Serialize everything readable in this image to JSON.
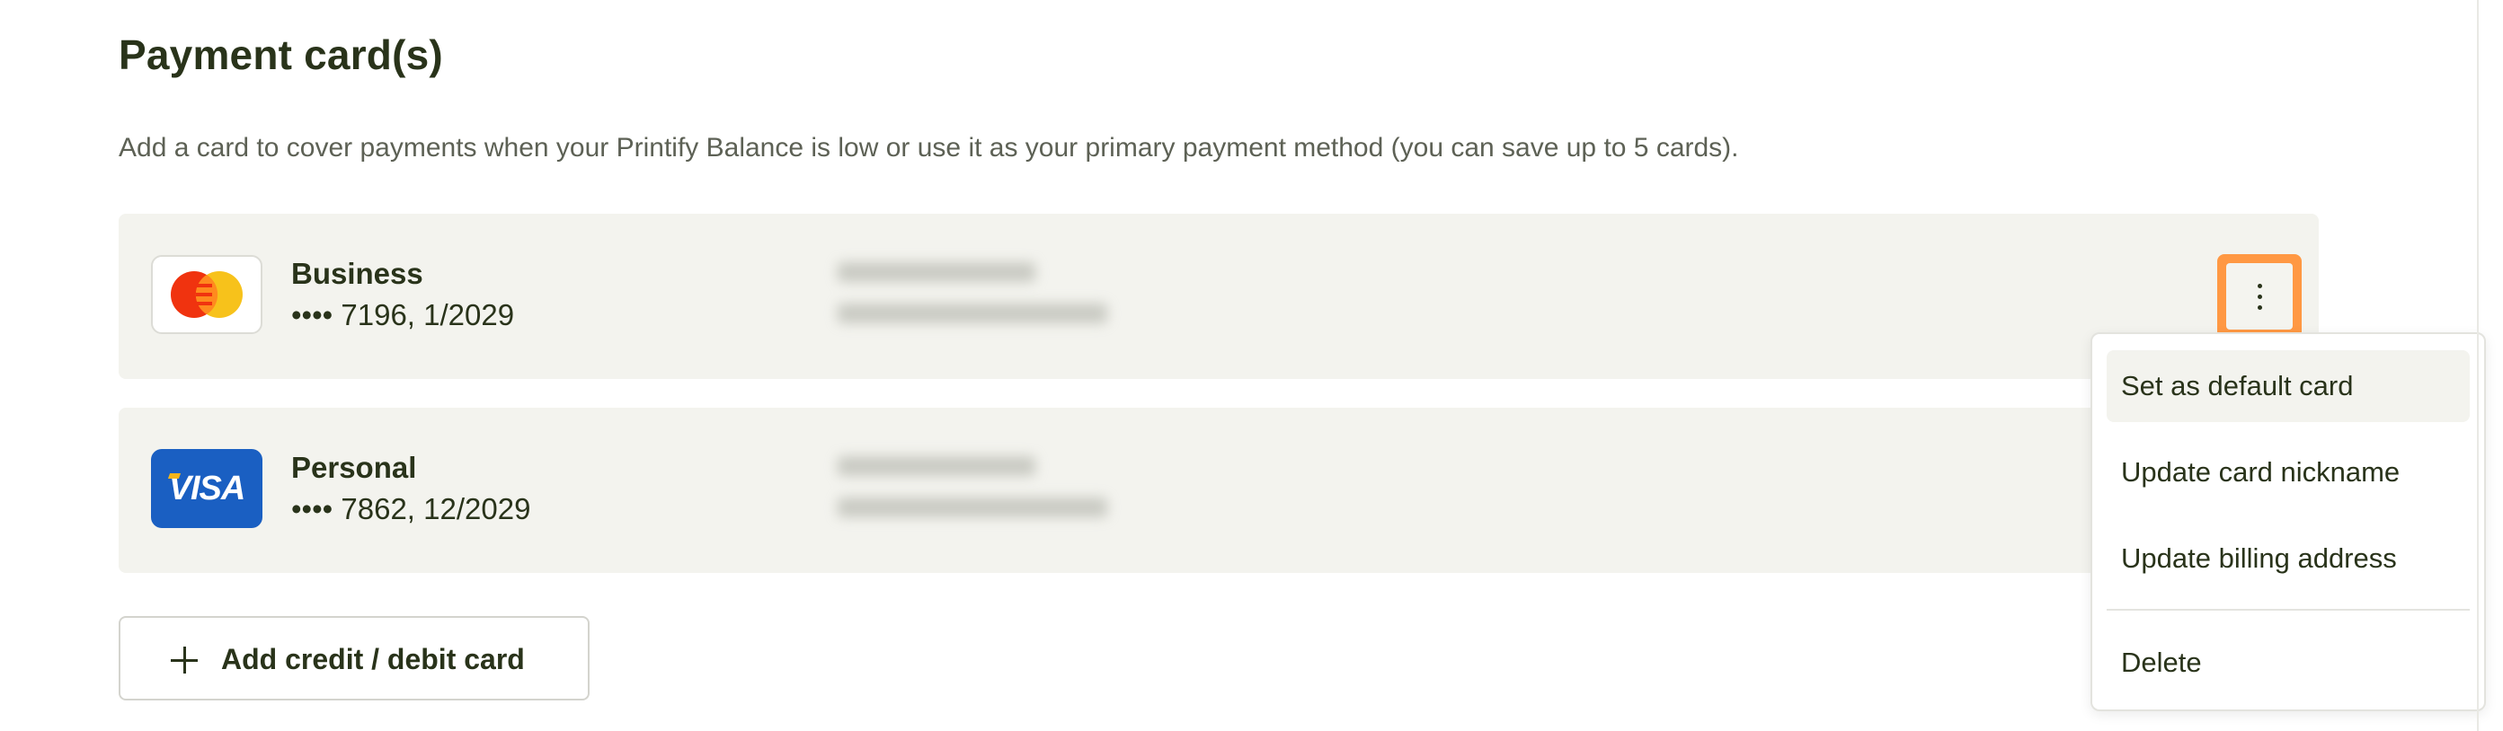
{
  "section": {
    "title": "Payment card(s)",
    "description": "Add a card to cover payments when your Printify Balance is low or use it as your primary payment method (you can save up to 5 cards)."
  },
  "cards": [
    {
      "brand": "mastercard",
      "brand_icon": "mastercard-logo-icon",
      "nickname": "Business",
      "number": "•••• 7196, 1/2029"
    },
    {
      "brand": "visa",
      "brand_icon": "visa-logo-icon",
      "brand_label": "VISA",
      "nickname": "Personal",
      "number": "•••• 7862, 12/2029"
    }
  ],
  "menu": {
    "items": [
      {
        "label": "Set as default card"
      },
      {
        "label": "Update card nickname"
      },
      {
        "label": "Update billing address"
      },
      {
        "label": "Delete"
      }
    ]
  },
  "add_card": {
    "label": "Add credit / debit card",
    "icon": "plus-icon"
  },
  "colors": {
    "row_bg": "#f3f3ee",
    "highlight": "#ff9843",
    "text": "#29331a",
    "visa_blue": "#1a5fc2",
    "mc_red": "#eb001b",
    "mc_yellow": "#f79e1b"
  }
}
